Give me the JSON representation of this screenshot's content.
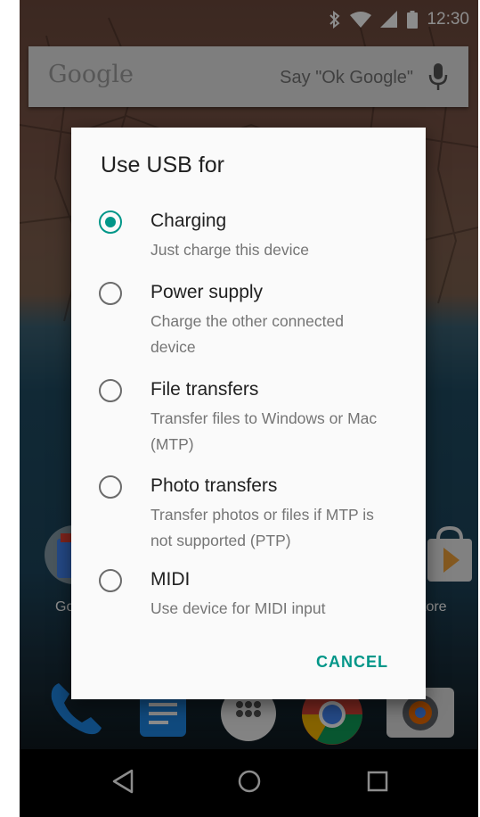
{
  "status_bar": {
    "time": "12:30",
    "icons": [
      "bluetooth-icon",
      "wifi-icon",
      "cell-signal-icon",
      "battery-icon"
    ]
  },
  "search_bar": {
    "logo": "Google",
    "hint": "Say \"Ok Google\"",
    "mic_icon": "mic-icon"
  },
  "home": {
    "left_label": "Go",
    "right_label": "tore",
    "dock_icons": [
      "phone-icon",
      "messages-icon",
      "app-drawer-icon",
      "chrome-icon",
      "camera-icon"
    ]
  },
  "dialog": {
    "title": "Use USB for",
    "options": [
      {
        "title": "Charging",
        "subtitle": "Just charge this device",
        "selected": true
      },
      {
        "title": "Power supply",
        "subtitle": "Charge the other connected device",
        "selected": false
      },
      {
        "title": "File transfers",
        "subtitle": "Transfer files to Windows or Mac (MTP)",
        "selected": false
      },
      {
        "title": "Photo transfers",
        "subtitle": "Transfer photos or files if MTP is not supported (PTP)",
        "selected": false
      },
      {
        "title": "MIDI",
        "subtitle": "Use device for MIDI input",
        "selected": false
      }
    ],
    "cancel_label": "CANCEL"
  },
  "nav_bar": {
    "buttons": [
      "back-icon",
      "home-icon",
      "recents-icon"
    ]
  },
  "colors": {
    "accent": "#009688",
    "radio_unchecked": "#6b6b6b",
    "dialog_bg": "#fafafa"
  }
}
